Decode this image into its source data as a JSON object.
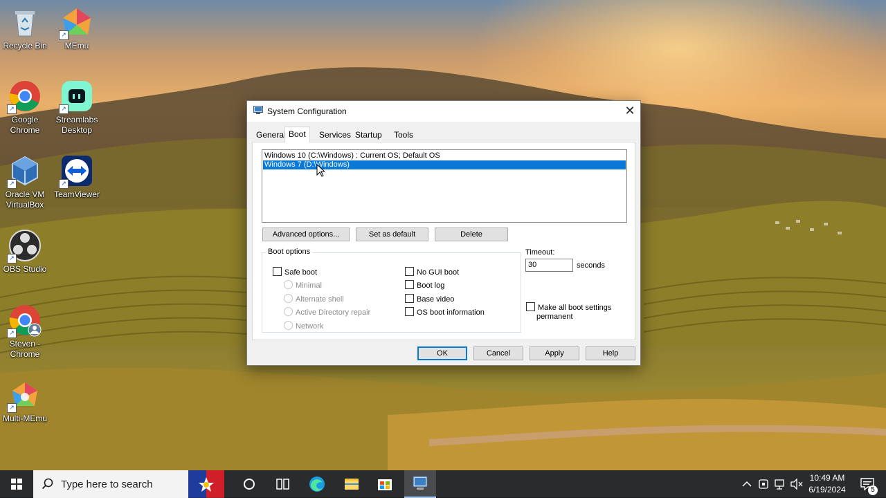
{
  "desktop": {
    "icons": [
      {
        "label": "Recycle Bin"
      },
      {
        "label": "MEmu"
      },
      {
        "label": "Google Chrome"
      },
      {
        "label": "Streamlabs Desktop"
      },
      {
        "label": "Oracle VM VirtualBox"
      },
      {
        "label": "TeamViewer"
      },
      {
        "label": "OBS Studio"
      },
      {
        "label": "Steven - Chrome"
      },
      {
        "label": "Multi-MEmu"
      }
    ]
  },
  "dialog": {
    "title": "System Configuration",
    "close_label": "✕",
    "tabs": [
      "General",
      "Boot",
      "Services",
      "Startup",
      "Tools"
    ],
    "active_tab": "Boot",
    "os_list": [
      "Windows 10 (C:\\Windows) : Current OS; Default OS",
      "Windows 7 (D:\\Windows)"
    ],
    "selected_os_index": 1,
    "buttons": {
      "advanced": "Advanced options...",
      "set_default": "Set as default",
      "delete": "Delete"
    },
    "boot_options": {
      "group_label": "Boot options",
      "safe_boot": "Safe boot",
      "minimal": "Minimal",
      "alternate_shell": "Alternate shell",
      "ad_repair": "Active Directory repair",
      "network": "Network",
      "no_gui_boot": "No GUI boot",
      "boot_log": "Boot log",
      "base_video": "Base video",
      "os_boot_info": "OS boot information"
    },
    "timeout": {
      "label": "Timeout:",
      "value": "30",
      "unit": "seconds"
    },
    "permanent_line1": "Make all boot settings",
    "permanent_line2": "permanent",
    "footer": {
      "ok": "OK",
      "cancel": "Cancel",
      "apply": "Apply",
      "help": "Help"
    }
  },
  "taskbar": {
    "search_placeholder": "Type here to search",
    "time": "10:49 AM",
    "date": "6/19/2024",
    "notification_count": "5"
  }
}
